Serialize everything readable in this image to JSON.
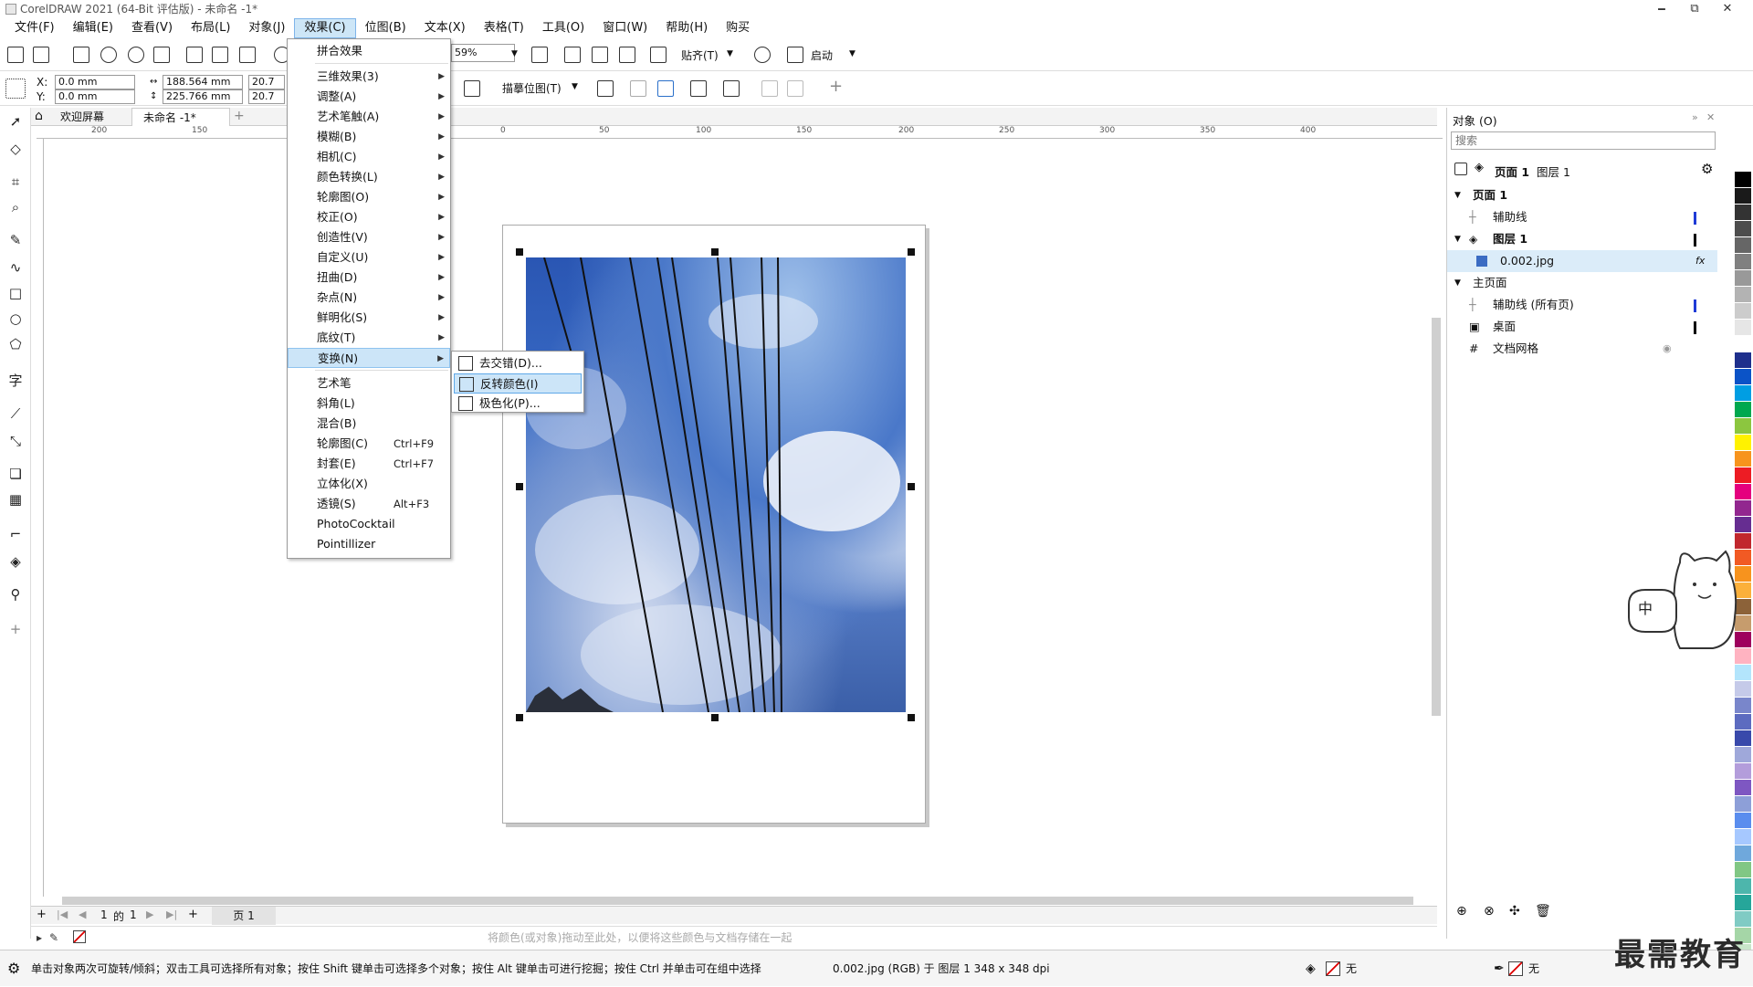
{
  "title": "CorelDRAW 2021 (64-Bit 评估版) - 未命名 -1*",
  "window_controls": [
    "🗕",
    "⧉",
    "✕"
  ],
  "menubar": [
    "文件(F)",
    "编辑(E)",
    "查看(V)",
    "布局(L)",
    "对象(J)",
    "效果(C)",
    "位图(B)",
    "文本(X)",
    "表格(T)",
    "工具(O)",
    "窗口(W)",
    "帮助(H)",
    "购买"
  ],
  "toolbar": {
    "zoom": "59%",
    "snap_label": "贴齐(T)",
    "launch_label": "启动",
    "trace_label": "描摹位图(T)"
  },
  "props": {
    "x_label": "X:",
    "y_label": "Y:",
    "x": "0.0 mm",
    "y": "0.0 mm",
    "w": "188.564 mm",
    "h": "225.766 mm",
    "sx": "20.7",
    "sy": "20.7"
  },
  "tabs": {
    "welcome": "欢迎屏幕",
    "doc": "未命名 -1*"
  },
  "ruler_labels": [
    "200",
    "150",
    "0",
    "50",
    "100",
    "150",
    "200",
    "250",
    "300",
    "350",
    "400"
  ],
  "effects_menu": {
    "items": [
      {
        "label": "拼合效果",
        "arrow": false
      },
      {
        "label": "三维效果(3)",
        "arrow": true
      },
      {
        "label": "调整(A)",
        "arrow": true
      },
      {
        "label": "艺术笔触(A)",
        "arrow": true
      },
      {
        "label": "模糊(B)",
        "arrow": true
      },
      {
        "label": "相机(C)",
        "arrow": true
      },
      {
        "label": "颜色转换(L)",
        "arrow": true
      },
      {
        "label": "轮廓图(O)",
        "arrow": true
      },
      {
        "label": "校正(O)",
        "arrow": true
      },
      {
        "label": "创造性(V)",
        "arrow": true
      },
      {
        "label": "自定义(U)",
        "arrow": true
      },
      {
        "label": "扭曲(D)",
        "arrow": true
      },
      {
        "label": "杂点(N)",
        "arrow": true
      },
      {
        "label": "鲜明化(S)",
        "arrow": true
      },
      {
        "label": "底纹(T)",
        "arrow": true
      },
      {
        "label": "变换(N)",
        "arrow": true,
        "highlight": true
      },
      {
        "label": "艺术笔",
        "arrow": false
      },
      {
        "label": "斜角(L)",
        "arrow": false
      },
      {
        "label": "混合(B)",
        "arrow": false
      },
      {
        "label": "轮廓图(C)",
        "shortcut": "Ctrl+F9"
      },
      {
        "label": "封套(E)",
        "shortcut": "Ctrl+F7"
      },
      {
        "label": "立体化(X)",
        "arrow": false
      },
      {
        "label": "透镜(S)",
        "shortcut": "Alt+F3"
      },
      {
        "label": "PhotoCocktail",
        "arrow": false
      },
      {
        "label": "Pointillizer",
        "arrow": false
      }
    ]
  },
  "transform_submenu": [
    "去交错(D)...",
    "反转颜色(I)",
    "极色化(P)..."
  ],
  "objects_panel": {
    "title": "对象 (O)",
    "search_placeholder": "搜索",
    "header_page": "页面 1",
    "header_layer": "图层 1",
    "rows": [
      {
        "label": "页面 1",
        "indent": 0,
        "bold": true
      },
      {
        "label": "辅助线",
        "indent": 1
      },
      {
        "label": "图层 1",
        "indent": 1,
        "bold": true
      },
      {
        "label": "0.002.jpg",
        "indent": 2,
        "selected": true
      },
      {
        "label": "主页面",
        "indent": 0
      },
      {
        "label": "辅助线 (所有页)",
        "indent": 1
      },
      {
        "label": "桌面",
        "indent": 1
      },
      {
        "label": "文档网格",
        "indent": 1
      }
    ]
  },
  "page_nav": {
    "current": "1",
    "of": "的",
    "total": "1",
    "page_tab": "页 1"
  },
  "color_hint": "将颜色(或对象)拖动至此处，以便将这些颜色与文档存储在一起",
  "status": {
    "hint": "单击对象两次可旋转/倾斜；双击工具可选择所有对象；按住 Shift 键单击可选择多个对象；按住 Alt 键单击可进行挖掘；按住 Ctrl 并单击可在组中选择",
    "info": "0.002.jpg (RGB) 于 图层 1 348 x 348 dpi",
    "fill": "无",
    "outline": "无"
  },
  "watermark": "最需教育",
  "cat_text": "中",
  "palette": [
    "#ffffff",
    "#000000",
    "#1a1a1a",
    "#333333",
    "#4d4d4d",
    "#666666",
    "#808080",
    "#999999",
    "#b3b3b3",
    "#cccccc",
    "#e6e6e6",
    "#ffffff",
    "#1e2f8c",
    "#0b53c7",
    "#009ee3",
    "#00a84f",
    "#8cc63f",
    "#fff200",
    "#f7941d",
    "#ed1c24",
    "#e5007e",
    "#92278f",
    "#662d91",
    "#c1272d",
    "#f15a24",
    "#f7931e",
    "#fbb03b",
    "#8c6239",
    "#c69c6d",
    "#9e005d",
    "#ffb3c1",
    "#b3e5fc",
    "#c5cae9",
    "#7986cb",
    "#5c6bc0",
    "#3949ab",
    "#9fa8da",
    "#b39ddb",
    "#7e57c2",
    "#8d9fd8",
    "#5a8dee",
    "#a6c8ff",
    "#6fa8dc",
    "#81c784",
    "#4db6ac",
    "#26a69a",
    "#80cbc4",
    "#a5d6a7",
    "#c8e6c9"
  ]
}
